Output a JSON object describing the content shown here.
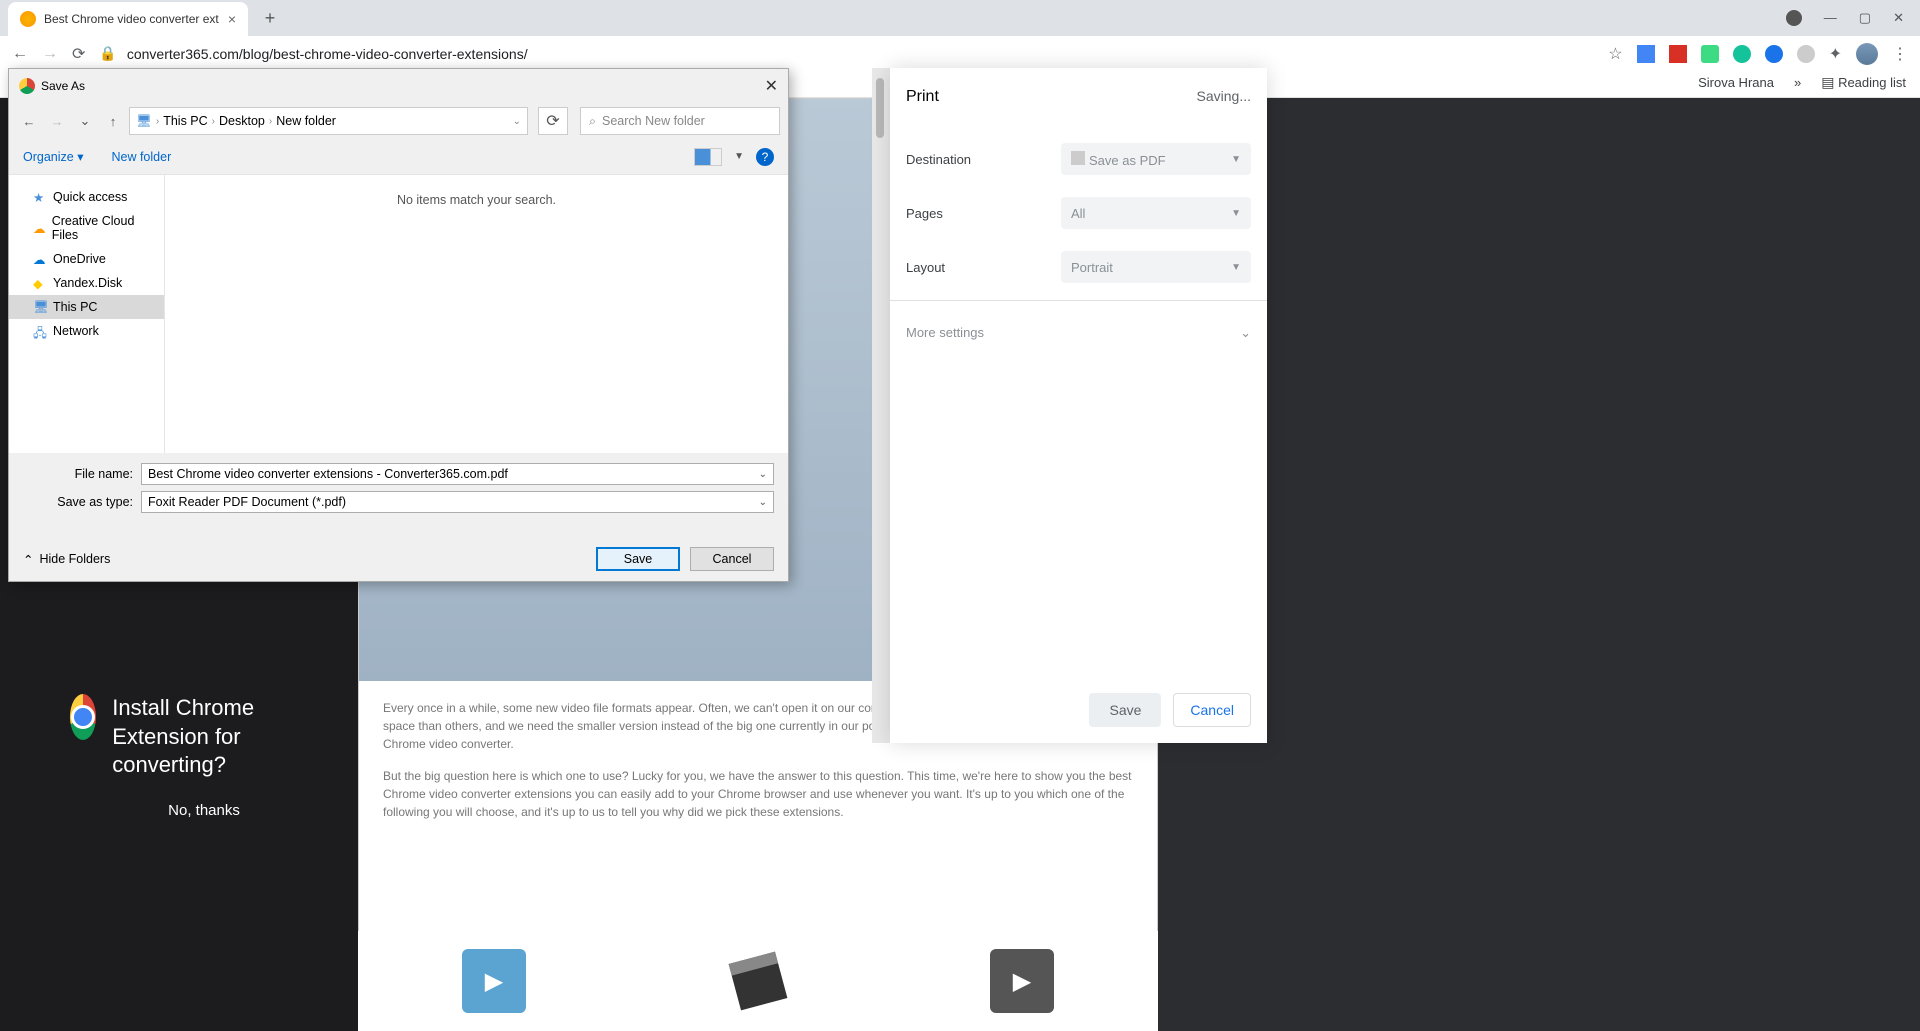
{
  "browser": {
    "tab_title": "Best Chrome video converter ext",
    "url": "converter365.com/blog/best-chrome-video-converter-extensions/",
    "bookmark_item": "Sirova Hrana",
    "reading_list": "Reading list"
  },
  "promo": {
    "heading": "Install Chrome Extension for converting?",
    "no_thanks": "No, thanks"
  },
  "article": {
    "p1": "Every once in a while, some new video file formats appear. Often, we can't open it on our computer. Or some file formats take more storage space than others, and we need the smaller version instead of the big one currently in our possession. If that happens, it's good to have a Chrome video converter.",
    "p2": "But the big question here is which one to use? Lucky for you, we have the answer to this question. This time, we're here to show you the best Chrome video converter extensions you can easily add to your Chrome browser and use whenever you want. It's up to you which one of the following you will choose, and it's up to us to tell you why did we pick these extensions."
  },
  "print": {
    "title": "Print",
    "status": "Saving...",
    "opt_dest": "Destination",
    "dest_val": "Save as PDF",
    "opt_pages": "Pages",
    "pages_val": "All",
    "opt_layout": "Layout",
    "layout_val": "Portrait",
    "more": "More settings",
    "btn_save": "Save",
    "btn_cancel": "Cancel"
  },
  "saveas": {
    "title": "Save As",
    "bc_pc": "This PC",
    "bc_desktop": "Desktop",
    "bc_folder": "New folder",
    "search_placeholder": "Search New folder",
    "organize": "Organize",
    "new_folder": "New folder",
    "tree": {
      "quick": "Quick access",
      "ccf": "Creative Cloud Files",
      "od": "OneDrive",
      "yd": "Yandex.Disk",
      "pc": "This PC",
      "net": "Network"
    },
    "empty_msg": "No items match your search.",
    "label_filename": "File name:",
    "filename": "Best Chrome video converter extensions - Converter365.com.pdf",
    "label_type": "Save as type:",
    "savetype": "Foxit Reader PDF Document (*.pdf)",
    "hide_folders": "Hide Folders",
    "btn_save": "Save",
    "btn_cancel": "Cancel"
  }
}
